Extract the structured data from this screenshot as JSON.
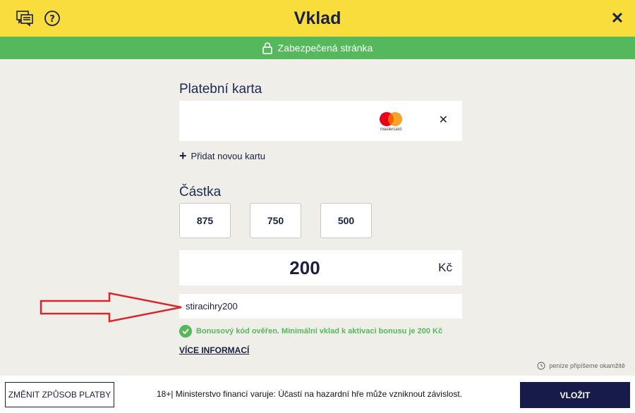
{
  "header": {
    "title": "Vklad",
    "close_label": "✕",
    "chat_icon": "chat-icon",
    "help_icon": "help-icon"
  },
  "secure_bar": {
    "text": "Zabezpečená stránka",
    "icon": "lock-icon"
  },
  "payment_card": {
    "section_title": "Platební karta",
    "card_brand": "mastercard",
    "remove_label": "✕",
    "add_card_label": "Přidat novou kartu"
  },
  "amount": {
    "section_title": "Částka",
    "presets": [
      "875",
      "750",
      "500"
    ],
    "value": "200",
    "currency": "Kč"
  },
  "bonus": {
    "code": "stiracihry200",
    "message": "Bonusový kód ověřen. Minimální vklad k aktivaci bonusu je 200 Kč",
    "more_info": "VÍCE INFORMACÍ"
  },
  "instant_note": "peníze připíšeme okamžitě",
  "footer": {
    "change_method": "ZMĚNIT ZPŮSOB PLATBY",
    "warning": "18+| Ministerstvo financí varuje: Účastí na hazardní hře může vzniknout závislost.",
    "submit": "VLOŽIT"
  },
  "colors": {
    "header_bg": "#f8dd3c",
    "secure_bg": "#56b85c",
    "page_bg": "#efeee8",
    "navy": "#161b4a",
    "arrow_red": "#d9252b"
  }
}
